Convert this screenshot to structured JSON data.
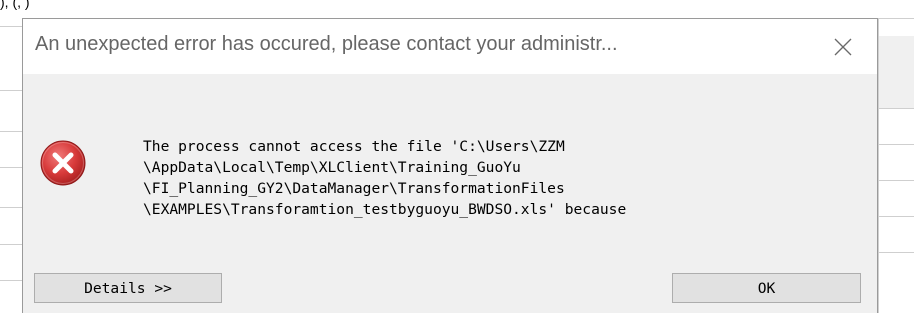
{
  "background": {
    "top_text": "),   (,  )"
  },
  "dialog": {
    "title": "An unexpected error has occured, please contact your administr...",
    "close_glyph": "✕",
    "icon": "error-icon",
    "message_lines": [
      "The process cannot access the file 'C:\\Users\\ZZM",
      "\\AppData\\Local\\Temp\\XLClient\\Training_GuoYu",
      "\\FI_Planning_GY2\\DataManager\\TransformationFiles",
      "\\EXAMPLES\\Transforamtion_testbyguoyu_BWDSO.xls' because"
    ],
    "buttons": {
      "details": "Details >>",
      "ok": "OK"
    }
  },
  "colors": {
    "error_red": "#d83b3b",
    "dialog_bg": "#f0f0f0",
    "button_bg": "#e1e1e1",
    "title_text": "#666666"
  }
}
